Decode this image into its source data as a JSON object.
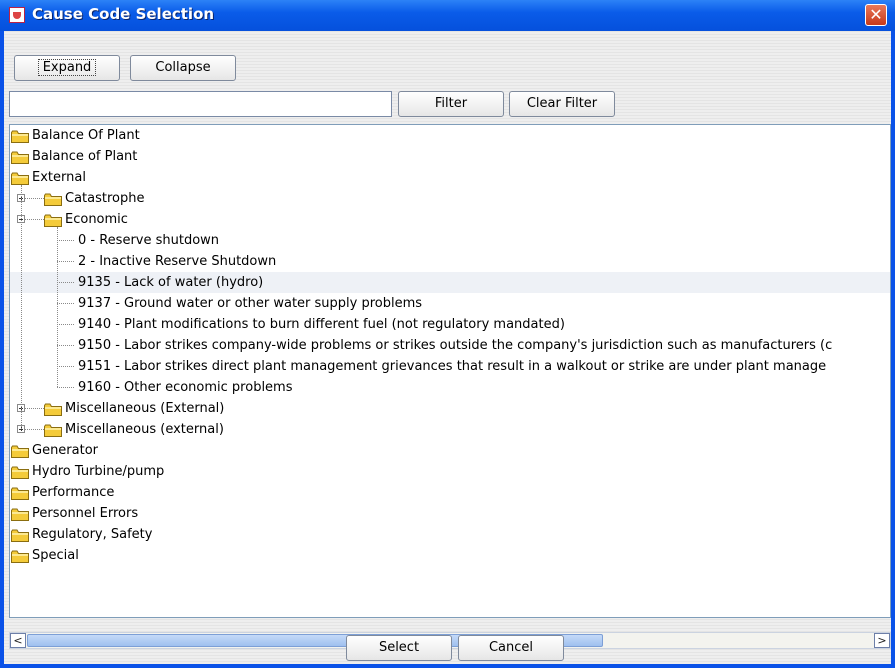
{
  "window": {
    "title": "Cause Code Selection"
  },
  "toolbar": {
    "expand_label": "Expand",
    "collapse_label": "Collapse"
  },
  "filter": {
    "value": "",
    "filter_label": "Filter",
    "clear_label": "Clear Filter"
  },
  "tree": {
    "root_items": [
      "Balance Of Plant",
      "Balance of Plant",
      "External",
      "Generator",
      "Hydro Turbine/pump",
      "Performance",
      "Personnel Errors",
      "Regulatory, Safety",
      "Special"
    ],
    "external_children": [
      "Catastrophe",
      "Economic",
      "Miscellaneous (External)",
      "Miscellaneous (external)"
    ],
    "economic_children": [
      "0 - Reserve shutdown",
      "2 - Inactive Reserve Shutdown",
      "9135 - Lack of water (hydro)",
      "9137 - Ground water or other water supply problems",
      "9140 - Plant modifications to burn different fuel (not regulatory mandated)",
      "9150 - Labor strikes company-wide problems or strikes outside the company's jurisdiction such as manufacturers (c",
      "9151 - Labor strikes direct plant management grievances that result in a walkout or strike are under plant manage",
      "9160 - Other economic problems"
    ]
  },
  "footer": {
    "select_label": "Select",
    "cancel_label": "Cancel"
  },
  "colors": {
    "titlebar": "#0a5ce9",
    "folder": "#f4cb3a",
    "scroll_thumb": "#b4cef4"
  }
}
